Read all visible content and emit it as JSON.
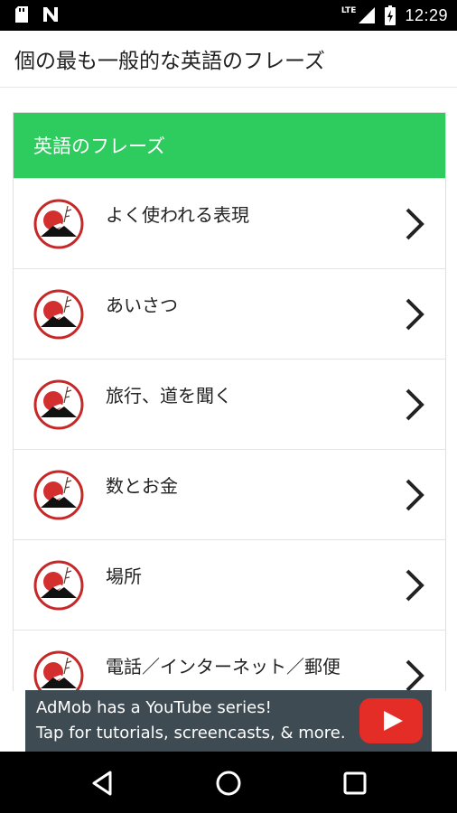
{
  "status_bar": {
    "time": "12:29",
    "network": "LTE",
    "left_icons": [
      "sd-card-icon",
      "n-notification-icon"
    ],
    "right_icons": [
      "signal-icon",
      "battery-charging-icon"
    ]
  },
  "app_bar": {
    "title": "個の最も一般的な英語のフレーズ"
  },
  "card": {
    "header": "英語のフレーズ",
    "header_color": "#2ecc5e",
    "items": [
      {
        "label": "よく使われる表現"
      },
      {
        "label": "あいさつ"
      },
      {
        "label": "旅行、道を聞く"
      },
      {
        "label": "数とお金"
      },
      {
        "label": "場所"
      },
      {
        "label": "電話／インターネット／郵便"
      }
    ]
  },
  "ad_banner": {
    "line1": "AdMob has a YouTube series!",
    "line2": "Tap for tutorials, screencasts, & more.",
    "background": "#3e4b52",
    "icon": "youtube-play-icon"
  },
  "nav_bar": {
    "buttons": [
      "back-icon",
      "home-icon",
      "recents-icon"
    ]
  }
}
